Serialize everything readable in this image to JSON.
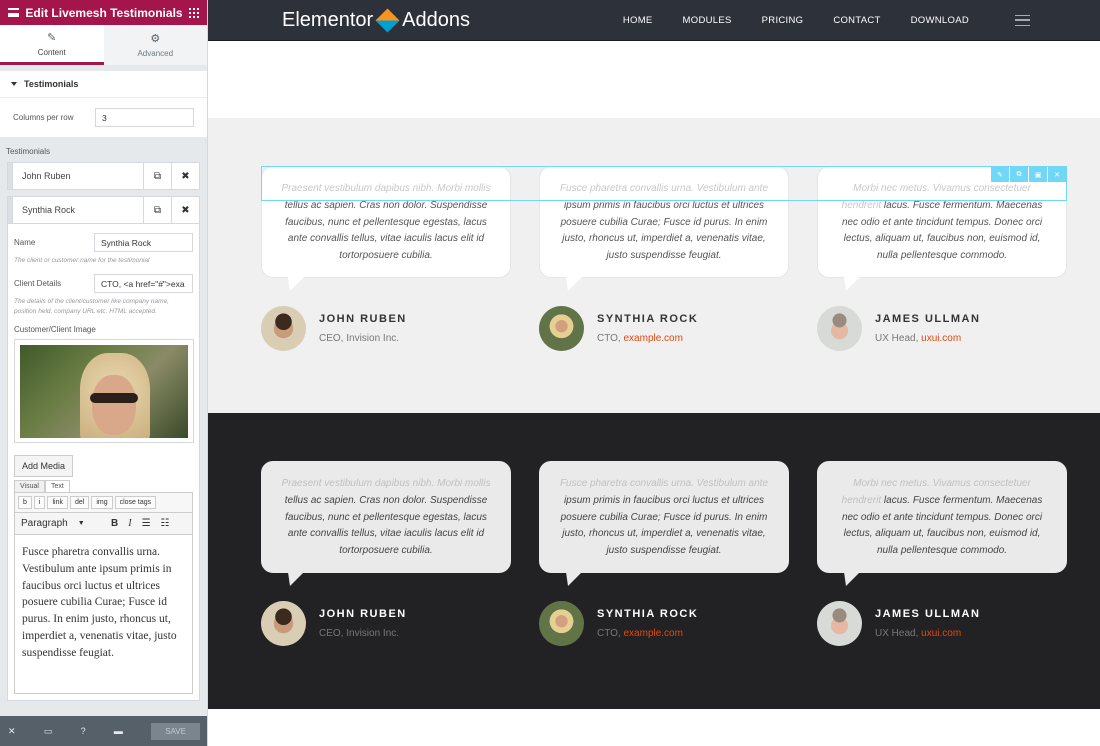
{
  "panel": {
    "title": "Edit Livemesh Testimonials",
    "tabs": [
      {
        "label": "Content",
        "icon": "pencil-icon"
      },
      {
        "label": "Advanced",
        "icon": "gear-icon"
      }
    ],
    "section_title": "Testimonials",
    "columns_label": "Columns per row",
    "columns_value": "3",
    "repeater_label": "Testimonials",
    "items": [
      "John Ruben",
      "Synthia Rock"
    ],
    "name_label": "Name",
    "name_value": "Synthia Rock",
    "name_desc": "The client or customer name for the testimonial",
    "details_label": "Client Details",
    "details_value": "CTO, <a href=\"#\">exa",
    "details_desc": "The details of the client/customer like company name, position held, company URL etc. HTML accepted.",
    "image_label": "Customer/Client Image",
    "add_media": "Add Media",
    "editor_tabs": [
      "Visual",
      "Text"
    ],
    "quicktags": [
      "b",
      "i",
      "link",
      "del",
      "img",
      "close tags"
    ],
    "format": "Paragraph",
    "editor_text": "Fusce pharetra convallis urna. Vestibulum ante ipsum primis in faucibus orci luctus et ultrices posuere cubilia Curae; Fusce id purus. In enim justo, rhoncus ut, imperdiet a, venenatis vitae, justo suspendisse feugiat.",
    "save_label": "SAVE"
  },
  "site": {
    "logo_left": "Elementor",
    "logo_right": "Addons",
    "menu": [
      "HOME",
      "MODULES",
      "PRICING",
      "CONTACT",
      "DOWNLOAD"
    ]
  },
  "testimonials": [
    {
      "fade": "Praesent vestibulum dapibus nibh. Morbi mollis",
      "text": "tellus ac sapien. Cras non dolor. Suspendisse faucibus, nunc et pellentesque egestas, lacus ante convallis tellus, vitae iaculis lacus elit id tortorposuere cubilia.",
      "name": "JOHN RUBEN",
      "role": "CEO, Invision Inc.",
      "link": ""
    },
    {
      "fade": "Fusce pharetra convallis urna. Vestibulum ante",
      "text": "ipsum primis in faucibus orci luctus et ultrices posuere cubilia Curae; Fusce id purus. In enim justo, rhoncus ut, imperdiet a, venenatis vitae, justo suspendisse feugiat.",
      "name": "SYNTHIA ROCK",
      "role": "CTO, ",
      "link": "example.com"
    },
    {
      "fade": "Morbi nec metus. Vivamus consectetuer hendrerit",
      "text": "lacus. Fusce fermentum. Maecenas nec odio et ante tincidunt tempus. Donec orci lectus, aliquam ut, faucibus non, euismod id, nulla pellentesque commodo.",
      "name": "JAMES ULLMAN",
      "role": "UX Head, ",
      "link": "uxui.com"
    }
  ],
  "colors": {
    "panel_header": "#a4164b",
    "nav_bg": "#2d3139",
    "link": "#e04a10",
    "selection": "#71d7f7"
  }
}
